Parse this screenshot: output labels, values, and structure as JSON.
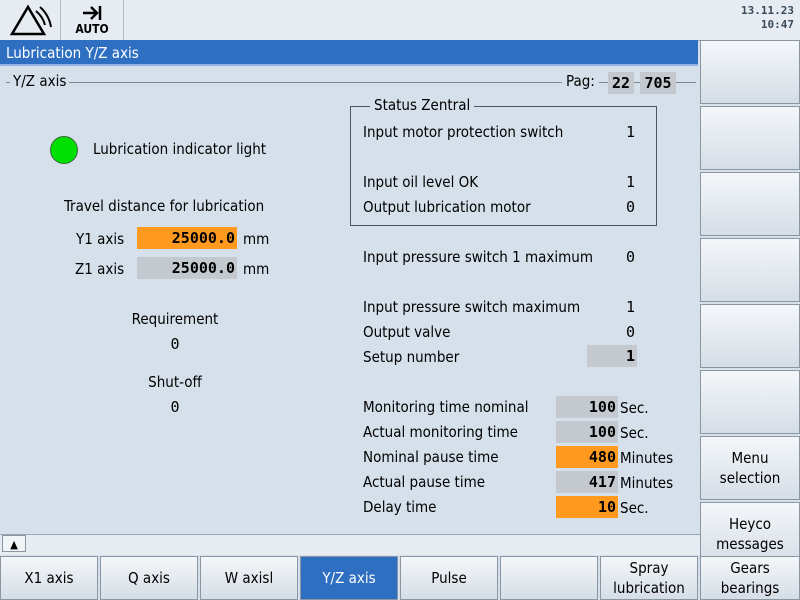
{
  "header": {
    "mode_label": "AUTO",
    "date": "13.11.23",
    "time": "10:47"
  },
  "title": "Lubrication Y/Z axis",
  "group": {
    "title": "Y/Z axis",
    "page_label": "Pag:",
    "page": "22",
    "page_total": "705"
  },
  "indicator": {
    "label": "Lubrication indicator light",
    "color": "#00e000"
  },
  "travel": {
    "heading": "Travel distance for lubrication",
    "y1_label": "Y1 axis",
    "y1_value": "25000.0",
    "z1_label": "Z1 axis",
    "z1_value": "25000.0",
    "unit": "mm"
  },
  "requirement": {
    "label": "Requirement",
    "value": "0"
  },
  "shutoff": {
    "label": "Shut-off",
    "value": "0"
  },
  "status": {
    "title": "Status Zentral",
    "items": [
      {
        "label": "Input motor protection switch",
        "value": "1"
      },
      {
        "label": "Input oil level OK",
        "value": "1"
      },
      {
        "label": "Output lubrication motor",
        "value": "0"
      }
    ]
  },
  "signals": [
    {
      "label": "Input pressure switch 1 maximum",
      "value": "0"
    },
    {
      "label": "Input pressure switch maximum",
      "value": "1"
    },
    {
      "label": "Output valve",
      "value": "0"
    }
  ],
  "setup": {
    "label": "Setup number",
    "value": "1"
  },
  "timers": [
    {
      "label": "Monitoring time nominal",
      "value": "100",
      "unit": "Sec."
    },
    {
      "label": "Actual monitoring time",
      "value": "100",
      "unit": "Sec."
    },
    {
      "label": "Nominal pause time",
      "value": "480",
      "unit": "Minutes"
    },
    {
      "label": "Actual pause time",
      "value": "417",
      "unit": "Minutes"
    },
    {
      "label": "Delay time",
      "value": "10",
      "unit": "Sec."
    }
  ],
  "right_softkeys": {
    "menu_selection": "Menu selection",
    "heyco_messages": "Heyco messages"
  },
  "bottom_softkeys": [
    "X1 axis",
    "Q axis",
    "W axisl",
    "Y/Z axis",
    "Pulse",
    "",
    "Spray lubrication",
    "Gears bearings"
  ],
  "colors": {
    "accent": "#2e6fc2",
    "edit_field": "#ff9a1e",
    "readonly_field": "#c3c9cf"
  }
}
